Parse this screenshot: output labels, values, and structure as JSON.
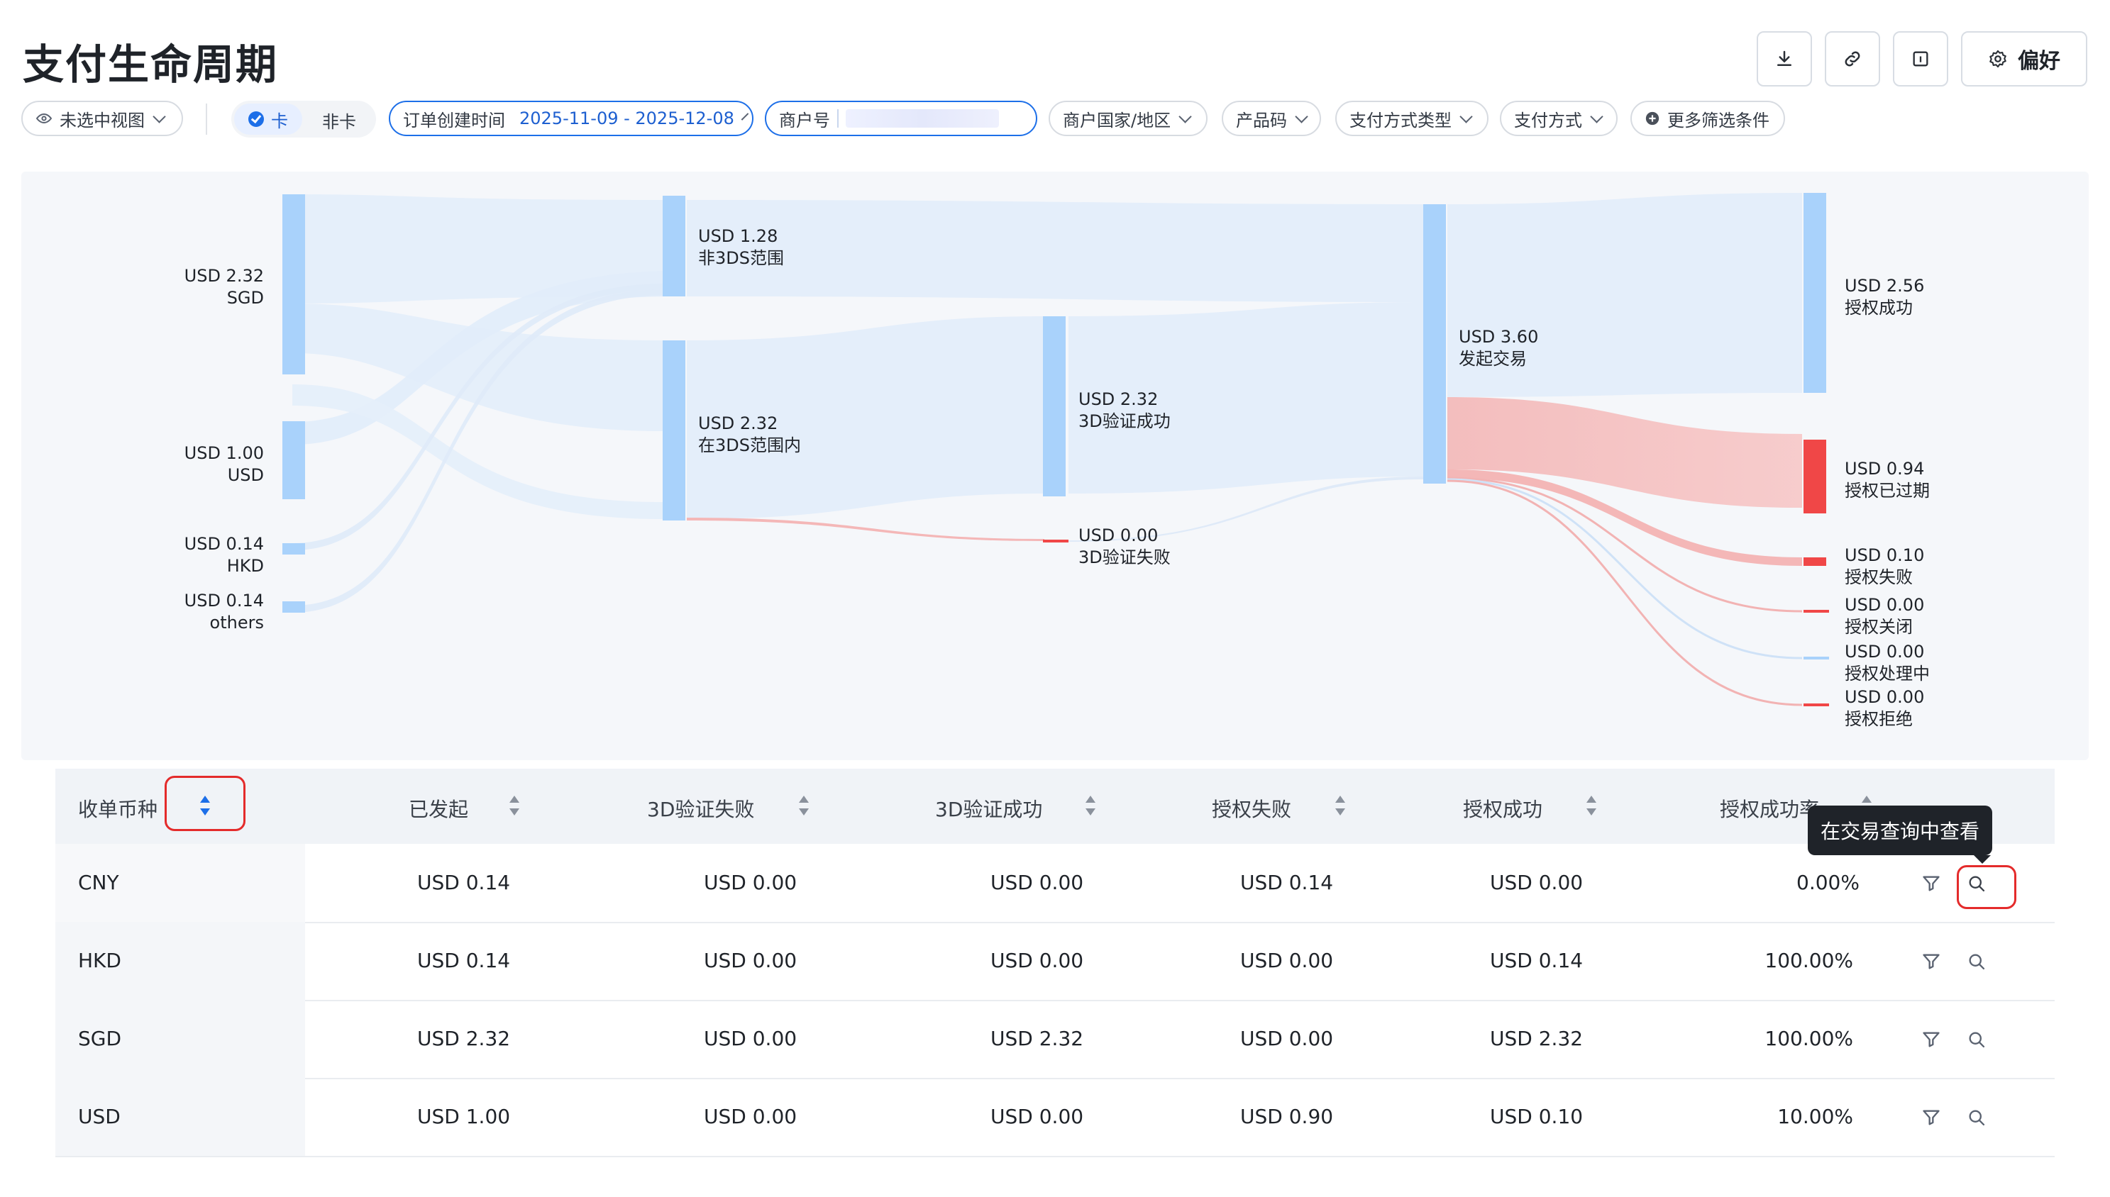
{
  "page": {
    "title": "支付生命周期"
  },
  "toolbar": {
    "download_icon": "download-icon",
    "link_icon": "link-icon",
    "panel_icon": "panel-icon",
    "pref_label": "偏好"
  },
  "filters": {
    "view": "未选中视图",
    "card_on": "卡",
    "card_off": "非卡",
    "order_time_label": "订单创建时间",
    "order_time_value": "2025-11-09 - 2025-12-08",
    "merchant_label": "商户号",
    "merchant_region": "商户国家/地区",
    "product_code": "产品码",
    "payment_type": "支付方式类型",
    "payment_method": "支付方式",
    "more_filters": "更多筛选条件"
  },
  "sankey": {
    "nodes": [
      {
        "id": "sgd",
        "value": "USD 2.32",
        "label": "SGD",
        "amount": 2.32,
        "color": "#a9d2fb"
      },
      {
        "id": "usd",
        "value": "USD 1.00",
        "label": "USD",
        "amount": 1.0,
        "color": "#a9d2fb"
      },
      {
        "id": "hkd",
        "value": "USD 0.14",
        "label": "HKD",
        "amount": 0.14,
        "color": "#a9d2fb"
      },
      {
        "id": "others",
        "value": "USD 0.14",
        "label": "others",
        "amount": 0.14,
        "color": "#a9d2fb"
      },
      {
        "id": "non3ds",
        "value": "USD 1.28",
        "label": "非3DS范围",
        "amount": 1.28,
        "color": "#a9d2fb"
      },
      {
        "id": "in3ds",
        "value": "USD 2.32",
        "label": "在3DS范围内",
        "amount": 2.32,
        "color": "#a9d2fb"
      },
      {
        "id": "ok3ds",
        "value": "USD 2.32",
        "label": "3D验证成功",
        "amount": 2.32,
        "color": "#a9d2fb"
      },
      {
        "id": "fail3ds",
        "value": "USD 0.00",
        "label": "3D验证失败",
        "amount": 0.0,
        "color": "#f04747"
      },
      {
        "id": "initiated",
        "value": "USD 3.60",
        "label": "发起交易",
        "amount": 3.6,
        "color": "#a9d2fb"
      },
      {
        "id": "auth_ok",
        "value": "USD 2.56",
        "label": "授权成功",
        "amount": 2.56,
        "color": "#a9d2fb"
      },
      {
        "id": "auth_expired",
        "value": "USD 0.94",
        "label": "授权已过期",
        "amount": 0.94,
        "color": "#f04747"
      },
      {
        "id": "auth_fail",
        "value": "USD 0.10",
        "label": "授权失败",
        "amount": 0.1,
        "color": "#f04747"
      },
      {
        "id": "auth_closed",
        "value": "USD 0.00",
        "label": "授权关闭",
        "amount": 0.0,
        "color": "#f04747"
      },
      {
        "id": "auth_pending",
        "value": "USD 0.00",
        "label": "授权处理中",
        "amount": 0.0,
        "color": "#a9d2fb"
      },
      {
        "id": "auth_reject",
        "value": "USD 0.00",
        "label": "授权拒绝",
        "amount": 0.0,
        "color": "#f04747"
      }
    ]
  },
  "table": {
    "headers": [
      "收单币种",
      "已发起",
      "3D验证失败",
      "3D验证成功",
      "授权失败",
      "授权成功",
      "授权成功率"
    ],
    "rows": [
      {
        "currency": "CNY",
        "initiated": "USD 0.14",
        "fail3ds": "USD 0.00",
        "ok3ds": "USD 0.00",
        "auth_fail": "USD 0.14",
        "auth_ok": "USD 0.00",
        "rate": "0.00%"
      },
      {
        "currency": "HKD",
        "initiated": "USD 0.14",
        "fail3ds": "USD 0.00",
        "ok3ds": "USD 0.00",
        "auth_fail": "USD 0.00",
        "auth_ok": "USD 0.14",
        "rate": "100.00%"
      },
      {
        "currency": "SGD",
        "initiated": "USD 2.32",
        "fail3ds": "USD 0.00",
        "ok3ds": "USD 2.32",
        "auth_fail": "USD 0.00",
        "auth_ok": "USD 2.32",
        "rate": "100.00%"
      },
      {
        "currency": "USD",
        "initiated": "USD 1.00",
        "fail3ds": "USD 0.00",
        "ok3ds": "USD 0.00",
        "auth_fail": "USD 0.90",
        "auth_ok": "USD 0.10",
        "rate": "10.00%"
      }
    ],
    "tooltip": "在交易查询中查看",
    "filter_icon": "filter-icon",
    "search_icon": "search-icon"
  }
}
